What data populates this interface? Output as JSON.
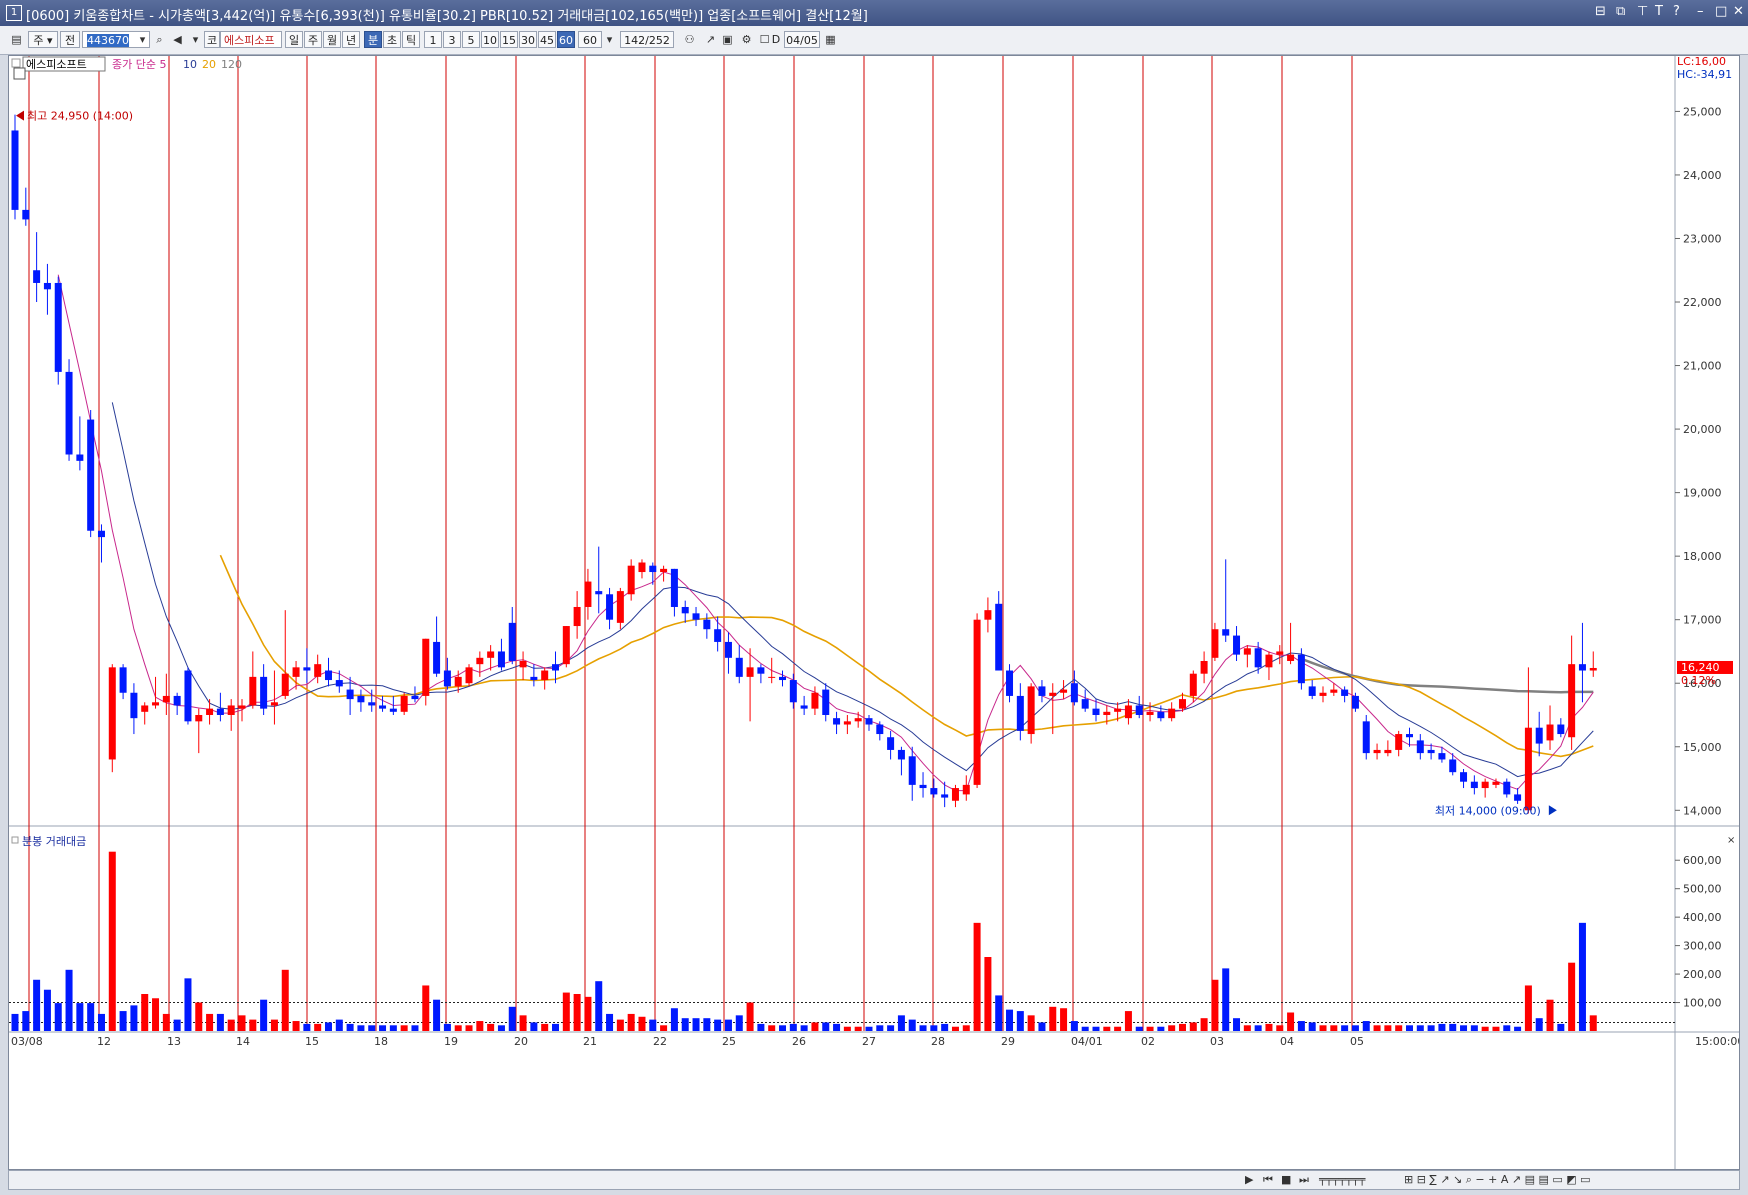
{
  "window": {
    "number": "1",
    "title": "[0600] 키움종합차트 - 시가총액[3,442(억)] 유통수[6,393(천)] 유통비율[30.2] PBR[10.52] 거래대금[102,165(백만)] 업종[소프트웨어] 결산[12월]"
  },
  "toolbar": {
    "market": "주",
    "market_sub": "전",
    "code": "443670",
    "code_prefix": "코",
    "stock_name": "에스피소프",
    "periods": [
      "일",
      "주",
      "월",
      "년",
      "분",
      "초",
      "틱"
    ],
    "active_period": "분",
    "intervals": [
      "1",
      "3",
      "5",
      "10",
      "15",
      "30",
      "45",
      "60"
    ],
    "active_interval": "60",
    "interval_value": "60",
    "count": "142",
    "count_total": "/252",
    "date": "04/05"
  },
  "legend": {
    "stock": "에스피소프트",
    "ma_prefix": "종가 단순",
    "ma_periods": [
      "5",
      "10",
      "20",
      "120"
    ]
  },
  "info": {
    "lc": "LC:16,00",
    "hc": "HC:-34,91"
  },
  "current_price": {
    "value": "16,240",
    "change": "0.12%"
  },
  "annotations": {
    "high": "최고 24,950 (14:00)",
    "low": "최저 14,000 (09:00)"
  },
  "volume_panel": {
    "title": "분봉 거래대금",
    "time": "15:00:00"
  },
  "colors": {
    "up": "#ff0000",
    "down": "#0019ff",
    "ma5": "#c8288c",
    "ma10": "#283c96",
    "ma20": "#e6a000",
    "ma120": "#808080",
    "divider": "#d00000"
  },
  "chart_data": {
    "type": "candlestick",
    "interval": "60min",
    "day_labels": [
      "03/08",
      "12",
      "13",
      "14",
      "15",
      "18",
      "19",
      "20",
      "21",
      "22",
      "25",
      "26",
      "27",
      "28",
      "29",
      "04/01",
      "02",
      "03",
      "04",
      "05"
    ],
    "y_price_ticks": [
      "25,000",
      "24,000",
      "23,000",
      "22,000",
      "21,000",
      "20,000",
      "19,000",
      "18,000",
      "17,000",
      "16,000",
      "15,000",
      "14,000"
    ],
    "y_volume_ticks": [
      "600,00",
      "500,00",
      "400,00",
      "300,00",
      "200,00",
      "100,00"
    ],
    "ylim_price": [
      13800,
      25400
    ],
    "ylim_volume": [
      0,
      650
    ],
    "volume_reference_levels": [
      100,
      30
    ],
    "candles": [
      [
        24700,
        24950,
        23300,
        23450,
        60
      ],
      [
        23450,
        23800,
        23200,
        23300,
        70
      ],
      [
        22500,
        23100,
        22000,
        22300,
        180
      ],
      [
        22300,
        22600,
        21800,
        22200,
        145
      ],
      [
        22300,
        22400,
        20700,
        20900,
        98
      ],
      [
        20900,
        21100,
        19500,
        19600,
        215
      ],
      [
        19600,
        20200,
        19350,
        19500,
        98
      ],
      [
        20150,
        20300,
        18300,
        18400,
        98
      ],
      [
        18400,
        18500,
        17900,
        18300,
        60
      ],
      [
        14800,
        16300,
        14600,
        16250,
        630
      ],
      [
        16250,
        16300,
        15750,
        15850,
        70
      ],
      [
        15850,
        16000,
        15200,
        15450,
        90
      ],
      [
        15550,
        15700,
        15350,
        15650,
        130
      ],
      [
        15650,
        16100,
        15600,
        15700,
        115
      ],
      [
        15700,
        16150,
        15500,
        15800,
        60
      ],
      [
        15800,
        15850,
        15500,
        15650,
        40
      ],
      [
        16200,
        16250,
        15350,
        15400,
        185
      ],
      [
        15400,
        15600,
        14900,
        15500,
        100
      ],
      [
        15500,
        15750,
        15350,
        15600,
        60
      ],
      [
        15600,
        15850,
        15400,
        15500,
        60
      ],
      [
        15500,
        15750,
        15250,
        15650,
        40
      ],
      [
        15600,
        15750,
        15400,
        15650,
        55
      ],
      [
        15650,
        16500,
        15600,
        16100,
        40
      ],
      [
        16100,
        16300,
        15500,
        15600,
        110
      ],
      [
        15650,
        16200,
        15350,
        15700,
        40
      ],
      [
        15800,
        17150,
        15750,
        16150,
        215
      ],
      [
        16100,
        16350,
        15900,
        16250,
        35
      ],
      [
        16250,
        16550,
        16000,
        16200,
        25
      ],
      [
        16100,
        16450,
        16000,
        16300,
        25
      ],
      [
        16200,
        16400,
        15950,
        16050,
        30
      ],
      [
        16050,
        16200,
        15850,
        15950,
        40
      ],
      [
        15900,
        16100,
        15500,
        15750,
        25
      ],
      [
        15800,
        15900,
        15550,
        15700,
        20
      ],
      [
        15700,
        15900,
        15550,
        15650,
        20
      ],
      [
        15650,
        15800,
        15550,
        15600,
        20
      ],
      [
        15600,
        15800,
        15500,
        15550,
        20
      ],
      [
        15550,
        15850,
        15500,
        15800,
        20
      ],
      [
        15800,
        15950,
        15700,
        15750,
        20
      ],
      [
        15800,
        16700,
        15650,
        16700,
        160
      ],
      [
        16650,
        17050,
        16100,
        16150,
        110
      ],
      [
        16200,
        16400,
        15900,
        15950,
        25
      ],
      [
        15950,
        16200,
        15850,
        16100,
        20
      ],
      [
        16000,
        16300,
        15950,
        16250,
        20
      ],
      [
        16300,
        16500,
        16100,
        16400,
        35
      ],
      [
        16400,
        16600,
        16200,
        16500,
        25
      ],
      [
        16500,
        16700,
        16200,
        16250,
        20
      ],
      [
        16950,
        17200,
        16300,
        16350,
        85
      ],
      [
        16250,
        16500,
        16050,
        16350,
        55
      ],
      [
        16100,
        16300,
        15950,
        16050,
        30
      ],
      [
        16050,
        16250,
        15900,
        16200,
        25
      ],
      [
        16300,
        16500,
        16000,
        16200,
        25
      ],
      [
        16300,
        16900,
        16250,
        16900,
        135
      ],
      [
        16900,
        17450,
        16700,
        17200,
        130
      ],
      [
        17200,
        17800,
        17000,
        17600,
        120
      ],
      [
        17450,
        18150,
        17100,
        17400,
        175
      ],
      [
        17400,
        17500,
        16850,
        17000,
        60
      ],
      [
        16950,
        17500,
        16850,
        17450,
        40
      ],
      [
        17400,
        17950,
        17300,
        17850,
        60
      ],
      [
        17750,
        17950,
        17650,
        17900,
        50
      ],
      [
        17850,
        17900,
        17550,
        17750,
        40
      ],
      [
        17750,
        17850,
        17600,
        17800,
        20
      ],
      [
        17800,
        17800,
        17050,
        17200,
        80
      ],
      [
        17200,
        17300,
        16950,
        17100,
        45
      ],
      [
        17100,
        17200,
        16900,
        17000,
        45
      ],
      [
        17000,
        17100,
        16700,
        16850,
        45
      ],
      [
        16850,
        17050,
        16500,
        16650,
        40
      ],
      [
        16650,
        16800,
        16150,
        16400,
        40
      ],
      [
        16400,
        16600,
        16000,
        16100,
        55
      ],
      [
        16100,
        16550,
        15400,
        16250,
        100
      ],
      [
        16250,
        16300,
        16000,
        16150,
        25
      ],
      [
        16100,
        16400,
        16000,
        16100,
        20
      ],
      [
        16100,
        16200,
        15950,
        16050,
        20
      ],
      [
        16050,
        16150,
        15600,
        15700,
        25
      ],
      [
        15650,
        15800,
        15500,
        15600,
        20
      ],
      [
        15600,
        15950,
        15500,
        15850,
        30
      ],
      [
        15900,
        16000,
        15400,
        15500,
        30
      ],
      [
        15450,
        15550,
        15200,
        15350,
        25
      ],
      [
        15350,
        15500,
        15200,
        15400,
        15
      ],
      [
        15400,
        15550,
        15300,
        15450,
        15
      ],
      [
        15450,
        15500,
        15250,
        15350,
        15
      ],
      [
        15350,
        15400,
        15100,
        15200,
        20
      ],
      [
        15150,
        15250,
        14800,
        14950,
        20
      ],
      [
        14950,
        15000,
        14550,
        14800,
        55
      ],
      [
        14850,
        15000,
        14150,
        14400,
        40
      ],
      [
        14400,
        14600,
        14200,
        14350,
        20
      ],
      [
        14350,
        14500,
        14200,
        14250,
        20
      ],
      [
        14250,
        14450,
        14050,
        14200,
        25
      ],
      [
        14150,
        14400,
        14050,
        14350,
        15
      ],
      [
        14250,
        14550,
        14150,
        14400,
        20
      ],
      [
        14400,
        17100,
        14350,
        17000,
        380
      ],
      [
        17000,
        17350,
        16800,
        17150,
        260
      ],
      [
        17250,
        17450,
        16200,
        16200,
        125
      ],
      [
        16200,
        16300,
        15700,
        15800,
        75
      ],
      [
        15800,
        16000,
        15100,
        15250,
        70
      ],
      [
        15200,
        16000,
        15050,
        15950,
        55
      ],
      [
        15950,
        16050,
        15700,
        15800,
        30
      ],
      [
        15800,
        16000,
        15200,
        15850,
        85
      ],
      [
        15850,
        16050,
        15750,
        15900,
        80
      ],
      [
        16000,
        16200,
        15650,
        15700,
        35
      ],
      [
        15750,
        15900,
        15550,
        15600,
        15
      ],
      [
        15600,
        15750,
        15400,
        15500,
        15
      ],
      [
        15500,
        15650,
        15350,
        15550,
        15
      ],
      [
        15550,
        15700,
        15400,
        15600,
        15
      ],
      [
        15450,
        15750,
        15350,
        15650,
        70
      ],
      [
        15650,
        15800,
        15450,
        15500,
        15
      ],
      [
        15500,
        15700,
        15400,
        15550,
        15
      ],
      [
        15550,
        15650,
        15400,
        15450,
        15
      ],
      [
        15450,
        15700,
        15400,
        15600,
        20
      ],
      [
        15600,
        15850,
        15550,
        15750,
        25
      ],
      [
        15800,
        16200,
        15700,
        16150,
        30
      ],
      [
        16150,
        16500,
        16000,
        16350,
        45
      ],
      [
        16400,
        16950,
        16350,
        16850,
        180
      ],
      [
        16850,
        17950,
        16650,
        16750,
        220
      ],
      [
        16750,
        16900,
        16350,
        16450,
        45
      ],
      [
        16450,
        16600,
        16250,
        16550,
        20
      ],
      [
        16550,
        16650,
        16150,
        16250,
        20
      ],
      [
        16250,
        16500,
        16050,
        16450,
        25
      ],
      [
        16450,
        16600,
        16300,
        16500,
        20
      ],
      [
        16350,
        16950,
        16300,
        16450,
        65
      ],
      [
        16450,
        16550,
        15900,
        16000,
        35
      ],
      [
        15950,
        16050,
        15750,
        15800,
        30
      ],
      [
        15800,
        15950,
        15700,
        15850,
        20
      ],
      [
        15850,
        16000,
        15800,
        15900,
        20
      ],
      [
        15900,
        15950,
        15700,
        15800,
        20
      ],
      [
        15800,
        15850,
        15550,
        15600,
        20
      ],
      [
        15400,
        15500,
        14800,
        14900,
        35
      ],
      [
        14900,
        15050,
        14800,
        14950,
        20
      ],
      [
        14900,
        15100,
        14850,
        14950,
        20
      ],
      [
        14950,
        15250,
        14850,
        15200,
        20
      ],
      [
        15200,
        15300,
        15000,
        15150,
        20
      ],
      [
        15100,
        15200,
        14800,
        14900,
        20
      ],
      [
        14950,
        15050,
        14800,
        14900,
        20
      ],
      [
        14900,
        15000,
        14750,
        14800,
        25
      ],
      [
        14800,
        14900,
        14550,
        14600,
        25
      ],
      [
        14600,
        14650,
        14350,
        14450,
        20
      ],
      [
        14450,
        14550,
        14250,
        14350,
        20
      ],
      [
        14350,
        14500,
        14200,
        14450,
        15
      ],
      [
        14400,
        14500,
        14350,
        14450,
        15
      ],
      [
        14450,
        14500,
        14200,
        14250,
        20
      ],
      [
        14250,
        14350,
        14100,
        14150,
        15
      ],
      [
        14000,
        16250,
        13950,
        15300,
        160
      ],
      [
        15300,
        15550,
        14850,
        15050,
        45
      ],
      [
        15100,
        15650,
        14950,
        15350,
        110
      ],
      [
        15350,
        15450,
        15150,
        15200,
        25
      ],
      [
        15150,
        16750,
        14950,
        16300,
        240
      ],
      [
        16300,
        16950,
        15700,
        16200,
        380
      ],
      [
        16200,
        16500,
        16100,
        16240,
        55
      ]
    ]
  }
}
